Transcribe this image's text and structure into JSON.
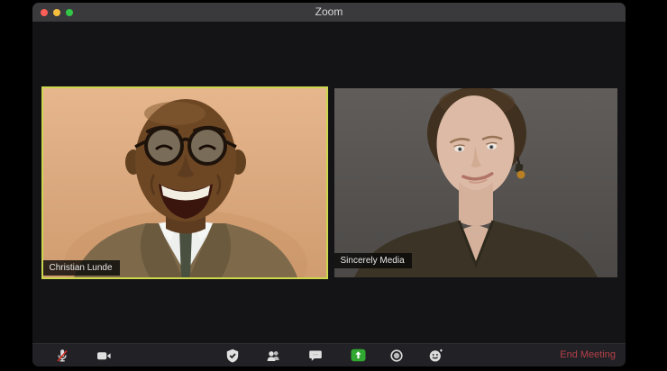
{
  "window": {
    "title": "Zoom"
  },
  "participants": [
    {
      "name": "Christian Lunde",
      "active_speaker": true
    },
    {
      "name": "Sincerely Media",
      "active_speaker": false
    }
  ],
  "toolbar": {
    "items": [
      {
        "icon": "microphone-muted-icon"
      },
      {
        "icon": "video-camera-icon"
      },
      {
        "icon": "security-shield-icon"
      },
      {
        "icon": "participants-icon"
      },
      {
        "icon": "chat-icon"
      },
      {
        "icon": "share-screen-icon"
      },
      {
        "icon": "record-icon"
      },
      {
        "icon": "reactions-icon"
      }
    ],
    "end_meeting_label": "End Meeting"
  },
  "colors": {
    "active_speaker_border": "#ccd64e",
    "share_screen_green": "#31a831",
    "end_meeting_red": "#b43f48",
    "traffic_red": "#ff5f57",
    "traffic_yellow": "#f6be3f",
    "traffic_green": "#33c748"
  }
}
